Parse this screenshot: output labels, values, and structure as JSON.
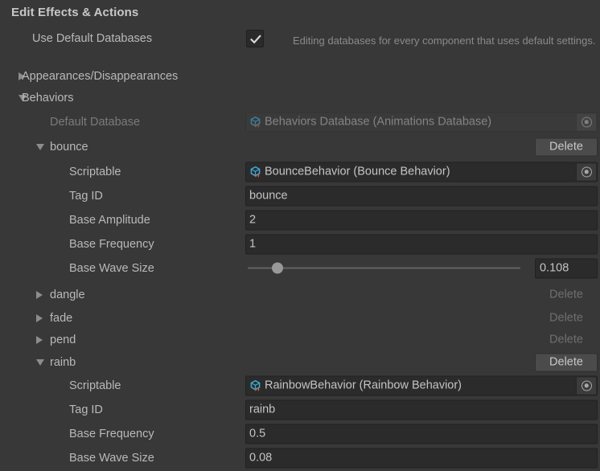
{
  "panel": {
    "title": "Edit Effects & Actions"
  },
  "use_default_databases": {
    "label": "Use Default Databases",
    "checked": true,
    "help": "Editing databases for every component that uses default settings."
  },
  "groups": [
    {
      "label": "Appearances/Disappearances",
      "expanded": false
    },
    {
      "label": "Behaviors",
      "expanded": true
    }
  ],
  "default_database": {
    "label": "Default Database",
    "value": "Behaviors Database (Animations Database)",
    "icon": "scriptable-object-icon",
    "picker_icon": "object-picker-icon",
    "disabled": true
  },
  "delete_label": "Delete",
  "entries": [
    {
      "name": "bounce",
      "expanded": true,
      "delete_enabled": true,
      "fields": [
        {
          "label": "Scriptable",
          "type": "object",
          "value": "BounceBehavior (Bounce Behavior)",
          "icon": "scriptable-object-icon"
        },
        {
          "label": "Tag ID",
          "type": "text",
          "value": "bounce"
        },
        {
          "label": "Base Amplitude",
          "type": "text",
          "value": "2"
        },
        {
          "label": "Base Frequency",
          "type": "text",
          "value": "1"
        },
        {
          "label": "Base Wave Size",
          "type": "slider",
          "value": "0.108",
          "slider_percent": 11
        }
      ]
    },
    {
      "name": "dangle",
      "expanded": false,
      "delete_enabled": false,
      "fields": []
    },
    {
      "name": "fade",
      "expanded": false,
      "delete_enabled": false,
      "fields": []
    },
    {
      "name": "pend",
      "expanded": false,
      "delete_enabled": false,
      "fields": []
    },
    {
      "name": "rainb",
      "expanded": true,
      "delete_enabled": true,
      "fields": [
        {
          "label": "Scriptable",
          "type": "object",
          "value": "RainbowBehavior (Rainbow Behavior)",
          "icon": "scriptable-object-icon"
        },
        {
          "label": "Tag ID",
          "type": "text",
          "value": "rainb"
        },
        {
          "label": "Base Frequency",
          "type": "text",
          "value": "0.5"
        },
        {
          "label": "Base Wave Size",
          "type": "text",
          "value": "0.08"
        }
      ]
    }
  ],
  "colors": {
    "background": "#383838",
    "field_background": "#2b2b2b",
    "text": "#b9b9b9",
    "text_dim": "#7b7b7b",
    "icon_cube": "#3da9d4",
    "icon_accent": "#d9622b"
  }
}
